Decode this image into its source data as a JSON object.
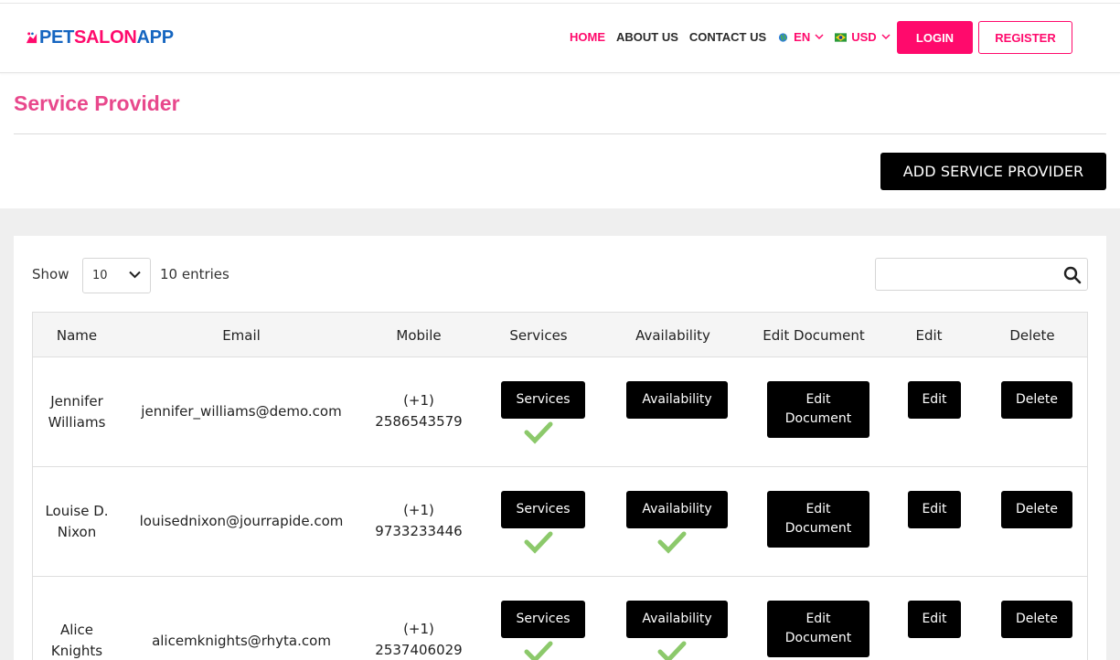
{
  "brand": {
    "pet": "PET",
    "salon": "SALON",
    "app": "APP",
    "accent": "#ff0a6c",
    "blue": "#1565c0"
  },
  "nav": {
    "home": "HOME",
    "about": "ABOUT US",
    "contact": "CONTACT US",
    "language": "EN",
    "currency": "USD",
    "login": "LOGIN",
    "register": "REGISTER"
  },
  "page": {
    "title": "Service Provider",
    "add_button": "ADD SERVICE PROVIDER"
  },
  "table_controls": {
    "show_label": "Show",
    "page_size": "10",
    "entries_text": "10 entries",
    "search_value": ""
  },
  "columns": [
    "Name",
    "Email",
    "Mobile",
    "Services",
    "Availability",
    "Edit Document",
    "Edit",
    "Delete"
  ],
  "rows": [
    {
      "name_first": "Jennifer",
      "name_last": "Williams",
      "email": "jennifer_williams@demo.com",
      "mobile_code": "(+1)",
      "mobile_number": "2586543579",
      "services_label": "Services",
      "services_done": true,
      "availability_label": "Availability",
      "availability_done": false,
      "edit_doc_line1": "Edit",
      "edit_doc_line2": "Document",
      "edit_label": "Edit",
      "delete_label": "Delete"
    },
    {
      "name_first": "Louise D.",
      "name_last": "Nixon",
      "email": "louisednixon@jourrapide.com",
      "mobile_code": "(+1)",
      "mobile_number": "9733233446",
      "services_label": "Services",
      "services_done": true,
      "availability_label": "Availability",
      "availability_done": true,
      "edit_doc_line1": "Edit",
      "edit_doc_line2": "Document",
      "edit_label": "Edit",
      "delete_label": "Delete"
    },
    {
      "name_first": "Alice",
      "name_last": "Knights",
      "email": "alicemknights@rhyta.com",
      "mobile_code": "(+1)",
      "mobile_number": "2537406029",
      "services_label": "Services",
      "services_done": true,
      "availability_label": "Availability",
      "availability_done": true,
      "edit_doc_line1": "Edit",
      "edit_doc_line2": "Document",
      "edit_label": "Edit",
      "delete_label": "Delete"
    }
  ],
  "colors": {
    "title_pink": "#e8488c",
    "check_green": "#8cc96b",
    "band_gray": "#efefef"
  },
  "icons": {
    "search": "search-icon",
    "check": "check-icon",
    "chevron": "chevron-down-icon",
    "globe": "globe-icon",
    "flag": "brazil-flag-icon"
  }
}
